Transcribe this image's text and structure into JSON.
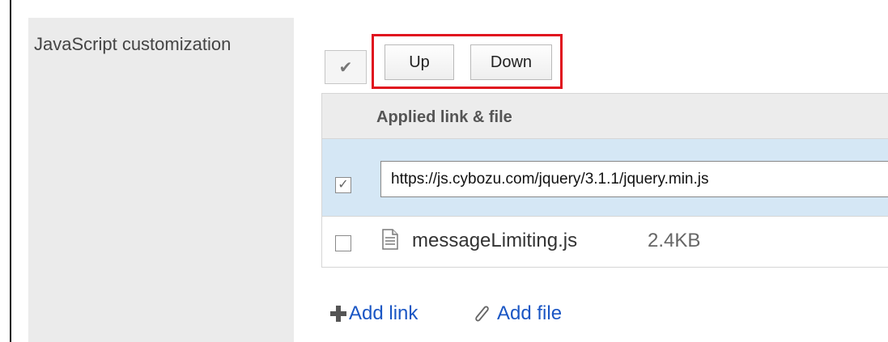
{
  "section": {
    "label": "JavaScript customization"
  },
  "toolbar": {
    "select_all_glyph": "✔",
    "up_label": "Up",
    "down_label": "Down",
    "highlight_color": "#e0121e"
  },
  "table": {
    "header": "Applied link & file",
    "rows": [
      {
        "type": "link",
        "checked": true,
        "check_glyph": "✓",
        "value": "https://js.cybozu.com/jquery/3.1.1/jquery.min.js",
        "selected_bg": "#d5e7f5"
      },
      {
        "type": "file",
        "checked": false,
        "icon": "file-icon",
        "name": "messageLimiting.js",
        "size": "2.4KB"
      }
    ]
  },
  "actions": {
    "add_link": {
      "icon": "plus-icon",
      "label": "Add link"
    },
    "add_file": {
      "icon": "paperclip-icon",
      "label": "Add file"
    }
  },
  "colors": {
    "link": "#1a56c4",
    "label_bg": "#ebebeb"
  }
}
